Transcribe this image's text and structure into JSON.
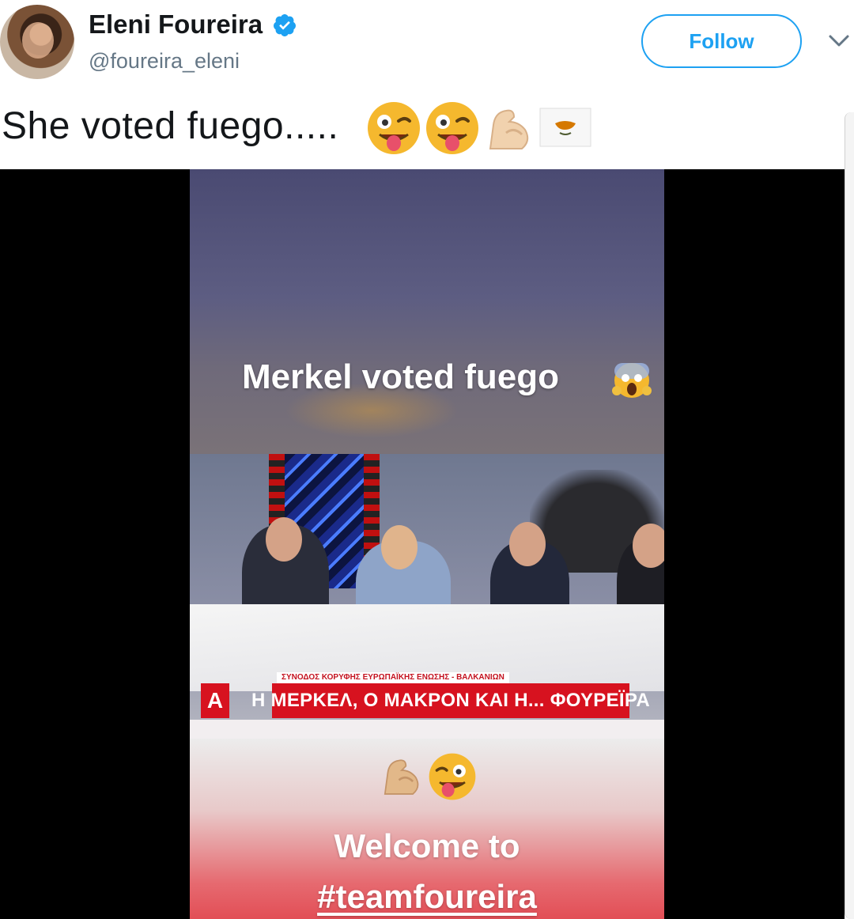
{
  "profile": {
    "name": "Eleni Foureira",
    "handle": "@foureira_eleni",
    "verified": true,
    "avatar_icon": "profile-avatar"
  },
  "actions": {
    "follow_label": "Follow",
    "more_icon": "chevron-down-icon"
  },
  "tweet": {
    "text": "She voted fuego.....",
    "emojis": [
      "winking-tongue-face",
      "winking-tongue-face",
      "flexed-biceps",
      "cyprus-flag"
    ]
  },
  "video": {
    "caption_top": "Merkel voted fuego",
    "caption_top_emoji": "screaming-face",
    "news_ticker_small": "ΣΥΝΟΔΟΣ ΚΟΡΥΦΗΣ ΕΥΡΩΠΑΪΚΗΣ ΕΝΩΣΗΣ - ΒΑΛΚΑΝΙΩΝ",
    "news_headline": "Η ΜΕΡΚΕΛ, Ο ΜΑΚΡΟΝ ΚΑΙ Η... ΦΟΥΡΕΪΡΑ",
    "news_logo": "A",
    "bottom_emojis": [
      "flexed-biceps",
      "winking-tongue-face"
    ],
    "caption_bottom_1": "Welcome to",
    "caption_bottom_2": "#teamfoureira"
  },
  "colors": {
    "accent": "#1da1f2",
    "text": "#14171a",
    "muted": "#657786",
    "news_red": "#d7121f"
  }
}
